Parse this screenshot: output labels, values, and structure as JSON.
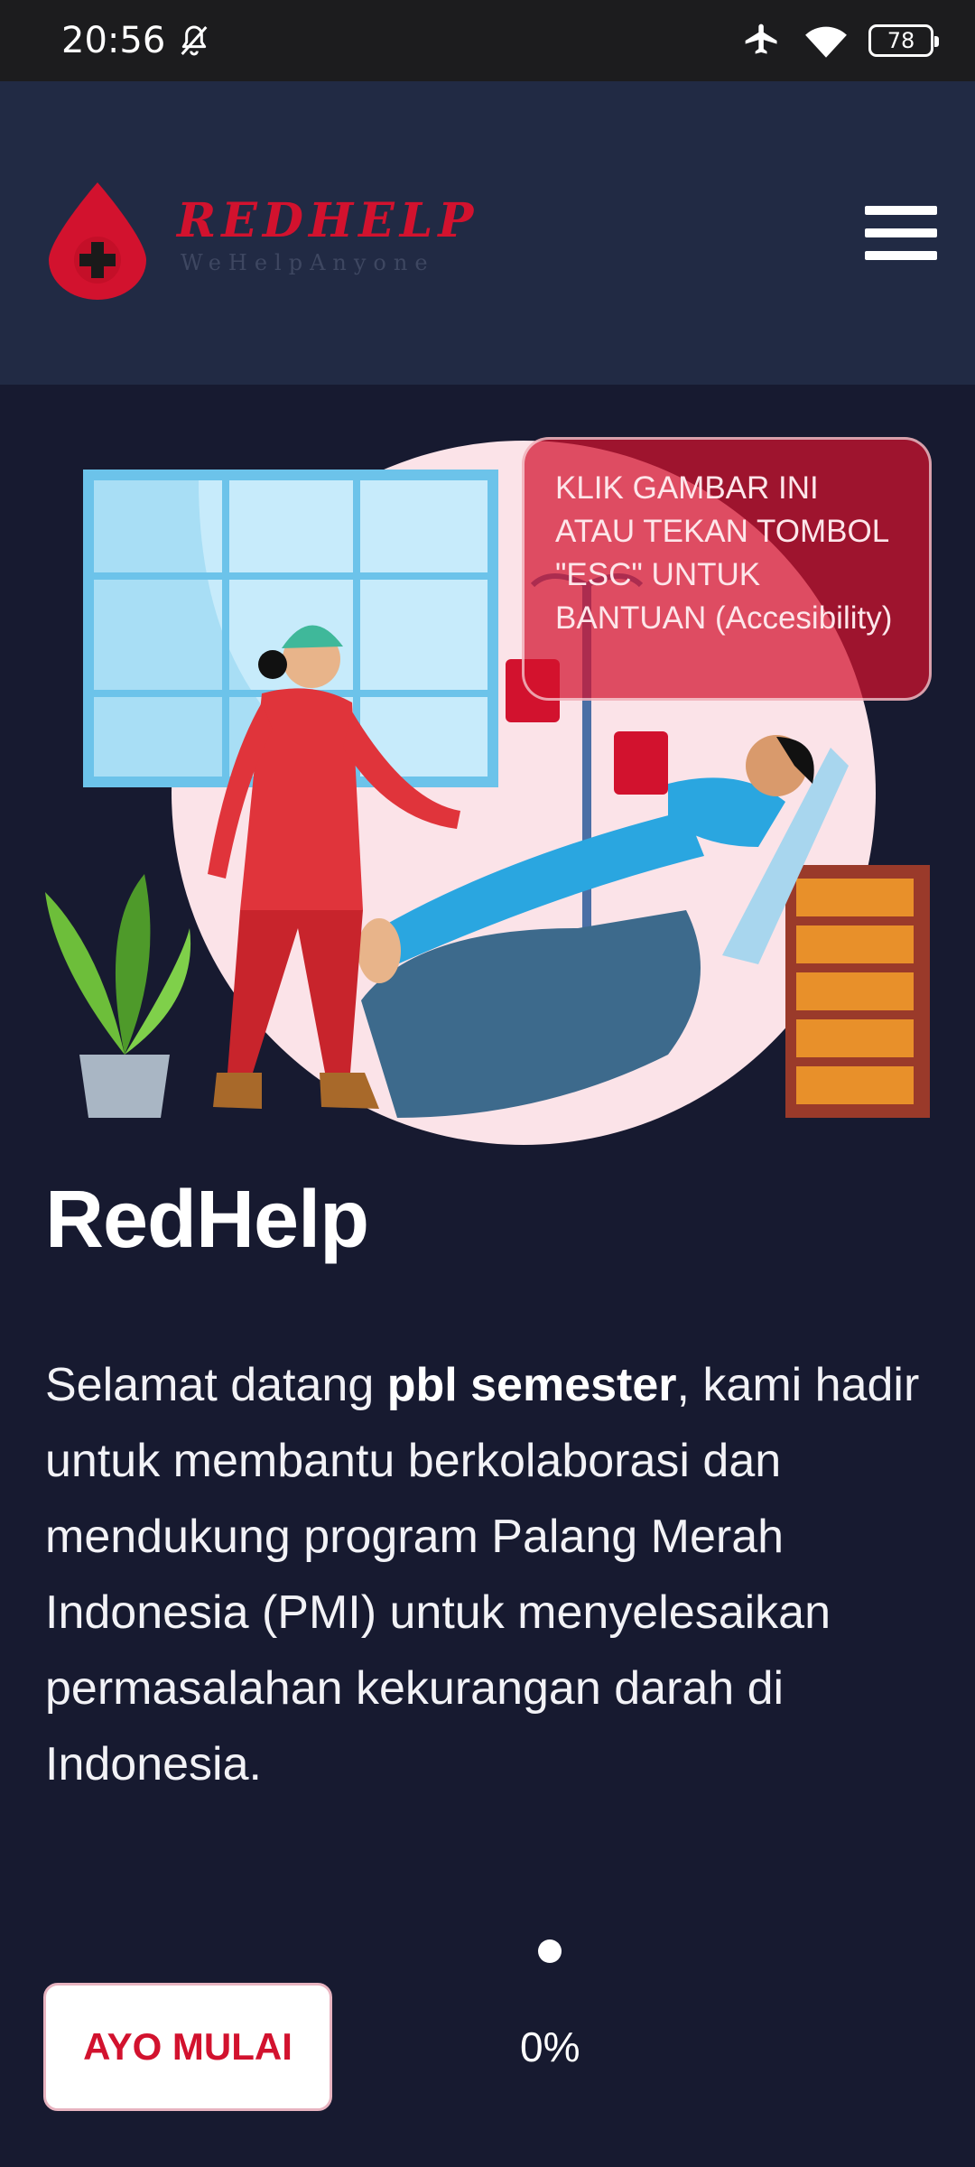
{
  "status_bar": {
    "time": "20:56",
    "battery": "78",
    "icons": [
      "bell-off-icon",
      "airplane-icon",
      "wifi-icon",
      "battery-icon"
    ]
  },
  "header": {
    "logo_name": "REDHELP",
    "logo_tagline": "WeHelpAnyone",
    "menu_icon": "hamburger-menu-icon"
  },
  "hero": {
    "hint_text": "KLIK GAMBAR INI ATAU TEKAN TOMBOL \"ESC\" UNTUK BANTUAN (Accesibility)"
  },
  "main": {
    "title": "RedHelp",
    "desc_prefix": "Selamat datang ",
    "desc_bold": "pbl semester",
    "desc_suffix": ", kami hadir untuk membantu berkolaborasi dan mendukung program Palang Merah Indonesia (PMI) untuk menyelesaikan permasalahan kekurangan darah di Indonesia.",
    "start_button": "AYO MULAI",
    "progress": "0%"
  },
  "colors": {
    "background": "#171a30",
    "header": "#212a44",
    "accent_red": "#d2122e",
    "status_bar": "#1c1c1e"
  }
}
